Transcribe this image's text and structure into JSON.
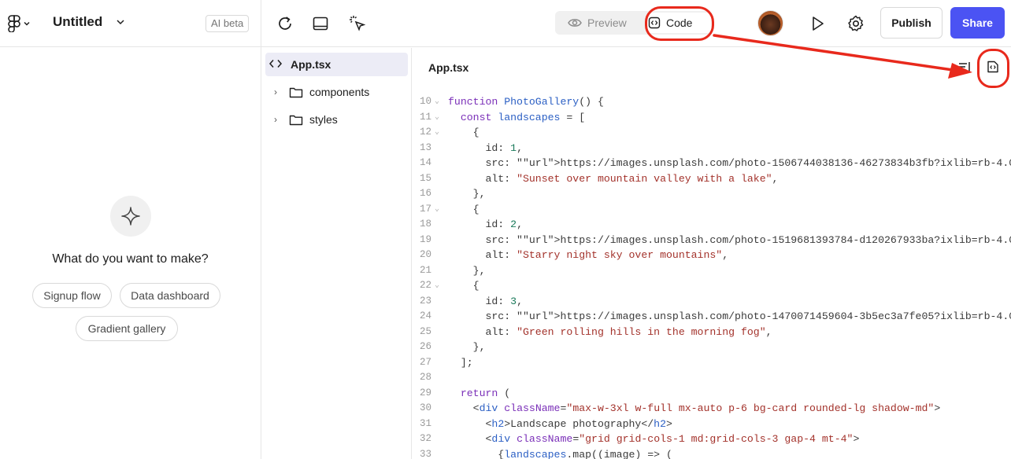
{
  "header": {
    "title": "Untitled",
    "ai_badge": "AI beta",
    "preview_label": "Preview",
    "code_label": "Code",
    "publish_label": "Publish",
    "share_label": "Share"
  },
  "empty_state": {
    "prompt": "What do you want to make?",
    "suggestions": [
      "Signup flow",
      "Data dashboard",
      "Gradient gallery"
    ]
  },
  "file_tree": {
    "items": [
      {
        "label": "App.tsx",
        "type": "file",
        "icon": "code-brackets-icon",
        "active": true
      },
      {
        "label": "components",
        "type": "folder",
        "icon": "folder-icon"
      },
      {
        "label": "styles",
        "type": "folder",
        "icon": "folder-icon"
      }
    ]
  },
  "editor": {
    "filename": "App.tsx",
    "lines": [
      {
        "n": "10",
        "fold": true,
        "text": "function PhotoGallery() {"
      },
      {
        "n": "11",
        "fold": true,
        "text": "  const landscapes = ["
      },
      {
        "n": "12",
        "fold": true,
        "text": "    {"
      },
      {
        "n": "13",
        "text": "      id: 1,"
      },
      {
        "n": "14",
        "text": "      src: \"https://images.unsplash.com/photo-1506744038136-46273834b3fb?ixlib=rb-4.0."
      },
      {
        "n": "15",
        "text": "      alt: \"Sunset over mountain valley with a lake\","
      },
      {
        "n": "16",
        "text": "    },"
      },
      {
        "n": "17",
        "fold": true,
        "text": "    {"
      },
      {
        "n": "18",
        "text": "      id: 2,"
      },
      {
        "n": "19",
        "text": "      src: \"https://images.unsplash.com/photo-1519681393784-d120267933ba?ixlib=rb-4.0."
      },
      {
        "n": "20",
        "text": "      alt: \"Starry night sky over mountains\","
      },
      {
        "n": "21",
        "text": "    },"
      },
      {
        "n": "22",
        "fold": true,
        "text": "    {"
      },
      {
        "n": "23",
        "text": "      id: 3,"
      },
      {
        "n": "24",
        "text": "      src: \"https://images.unsplash.com/photo-1470071459604-3b5ec3a7fe05?ixlib=rb-4.0."
      },
      {
        "n": "25",
        "text": "      alt: \"Green rolling hills in the morning fog\","
      },
      {
        "n": "26",
        "text": "    },"
      },
      {
        "n": "27",
        "text": "  ];"
      },
      {
        "n": "28",
        "text": ""
      },
      {
        "n": "29",
        "text": "  return ("
      },
      {
        "n": "30",
        "text": "    <div className=\"max-w-3xl w-full mx-auto p-6 bg-card rounded-lg shadow-md\">"
      },
      {
        "n": "31",
        "text": "      <h2>Landscape photography</h2>"
      },
      {
        "n": "32",
        "text": "      <div className=\"grid grid-cols-1 md:grid-cols-3 gap-4 mt-4\">"
      },
      {
        "n": "33",
        "text": "        {landscapes.map((image) => ("
      }
    ]
  },
  "colors": {
    "share_button": "#4b53f3",
    "annotation": "#e8291c",
    "active_file_bg": "#ececf6"
  },
  "icons": [
    "figma-logo-icon",
    "chevron-down-icon",
    "refresh-icon",
    "layout-panel-icon",
    "cursor-sparkle-icon",
    "eye-icon",
    "code-icon",
    "play-icon",
    "gear-icon",
    "sparkle-icon",
    "word-wrap-icon",
    "code-file-icon"
  ]
}
